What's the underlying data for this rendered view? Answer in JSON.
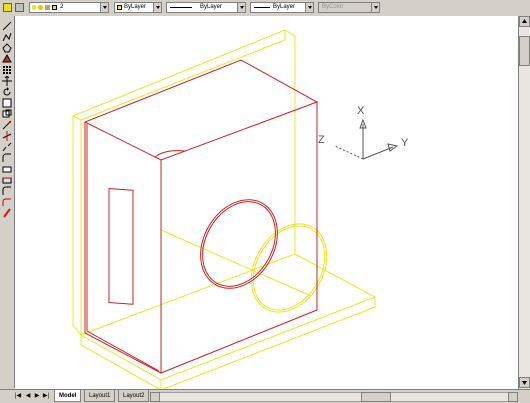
{
  "toolbar": {
    "layer_name": "2",
    "color_label": "ByLayer",
    "linetype_label": "ByLayer",
    "lineweight_label": "ByLayer",
    "plotstyle_label": "ByColor"
  },
  "ucs": {
    "x_label": "X",
    "y_label": "Y",
    "z_label": "Z"
  },
  "tabs": [
    {
      "label": "Model",
      "active": true
    },
    {
      "label": "Layout1",
      "active": false
    },
    {
      "label": "Layout2",
      "active": false
    }
  ],
  "nav_buttons": [
    "|◀",
    "◀",
    "▶",
    "▶|"
  ],
  "colors": {
    "object_red": "#cc2020",
    "object_yellow": "#e8e820",
    "ucs_grey": "#555555"
  },
  "tools": [
    "line-icon",
    "polyline-icon",
    "polygon-icon",
    "rectangle-icon",
    "array-icon",
    "move-icon",
    "rotate-icon",
    "scale-icon",
    "stretch-icon",
    "trim-icon",
    "extend-icon",
    "break-icon",
    "chamfer-icon",
    "fillet-icon",
    "explode-icon",
    "erase-icon",
    "copy-icon",
    "mirror-icon",
    "offset-icon"
  ]
}
